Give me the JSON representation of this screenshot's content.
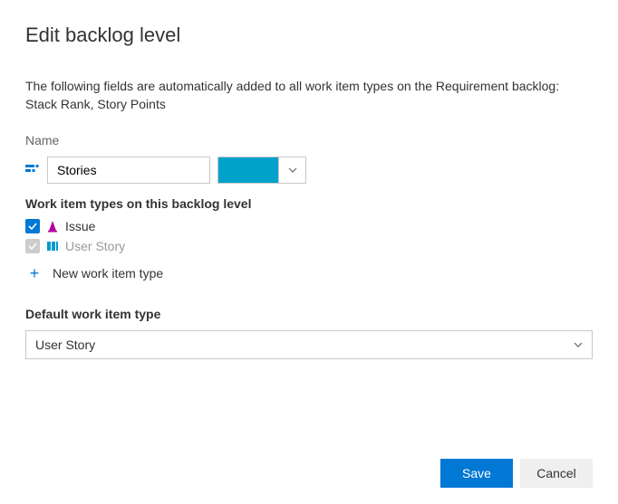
{
  "title": "Edit backlog level",
  "intro": "The following fields are automatically added to all work item types on the Requirement backlog: Stack Rank, Story Points",
  "nameLabel": "Name",
  "nameValue": "Stories",
  "swatchColor": "#00a2cc",
  "witSectionLabel": "Work item types on this backlog level",
  "workItemTypes": [
    {
      "label": "Issue",
      "checked": true,
      "disabled": false
    },
    {
      "label": "User Story",
      "checked": true,
      "disabled": true
    }
  ],
  "newTypeLabel": "New work item type",
  "defaultLabel": "Default work item type",
  "defaultValue": "User Story",
  "buttons": {
    "save": "Save",
    "cancel": "Cancel"
  }
}
